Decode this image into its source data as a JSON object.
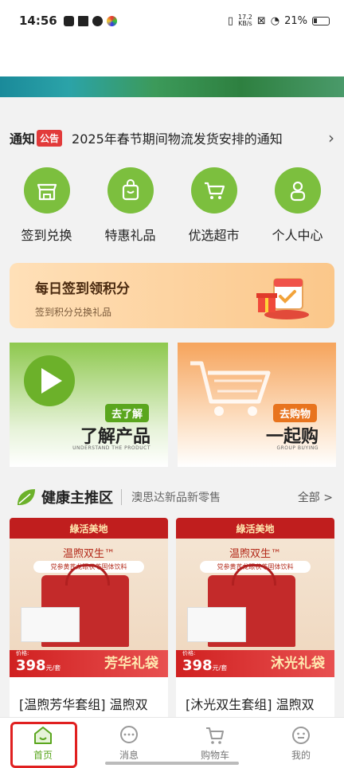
{
  "status": {
    "time": "14:56",
    "speed_value": "17.2",
    "speed_unit": "KB/s",
    "battery": "21%"
  },
  "notice": {
    "label": "通知",
    "tag": "公告",
    "text": "2025年春节期间物流发货安排的通知"
  },
  "shortcuts": [
    {
      "label": "签到兑换",
      "icon": "store-icon"
    },
    {
      "label": "特惠礼品",
      "icon": "gift-bag-icon"
    },
    {
      "label": "优选超市",
      "icon": "cart-icon"
    },
    {
      "label": "个人中心",
      "icon": "person-icon"
    }
  ],
  "checkin": {
    "title": "每日签到领积分",
    "subtitle": "签到积分兑换礼品"
  },
  "promo_left": {
    "tag": "去了解",
    "title": "了解产品",
    "subtitle": "UNDERSTAND THE PRODUCT"
  },
  "promo_right": {
    "tag": "去购物",
    "title": "一起购",
    "subtitle": "GROUP BUYING"
  },
  "section": {
    "title": "健康主推区",
    "subtitle": "澳思达新品新零售",
    "more": "全部 >"
  },
  "products": [
    {
      "brand": "綠活美地",
      "name": "温煦双生™",
      "desc": "党参黄芪龙眼茯苓固体饮料",
      "price_label": "价格:",
      "price": "398",
      "price_unit": "元/套",
      "gift": "芳华礼袋",
      "title": "[温煦芳华套组] 温煦双"
    },
    {
      "brand": "綠活美地",
      "name": "温煦双生™",
      "desc": "党参黄芪龙眼茯苓固体饮料",
      "price_label": "价格:",
      "price": "398",
      "price_unit": "元/套",
      "gift": "沐光礼袋",
      "title": "[沐光双生套组] 温煦双"
    }
  ],
  "tabs": [
    {
      "label": "首页",
      "icon": "home-icon"
    },
    {
      "label": "消息",
      "icon": "message-icon"
    },
    {
      "label": "购物车",
      "icon": "cart-icon"
    },
    {
      "label": "我的",
      "icon": "profile-icon"
    }
  ],
  "colors": {
    "accent": "#5aa61e",
    "icon_green": "#7cbf3e",
    "highlight": "#e02020"
  }
}
